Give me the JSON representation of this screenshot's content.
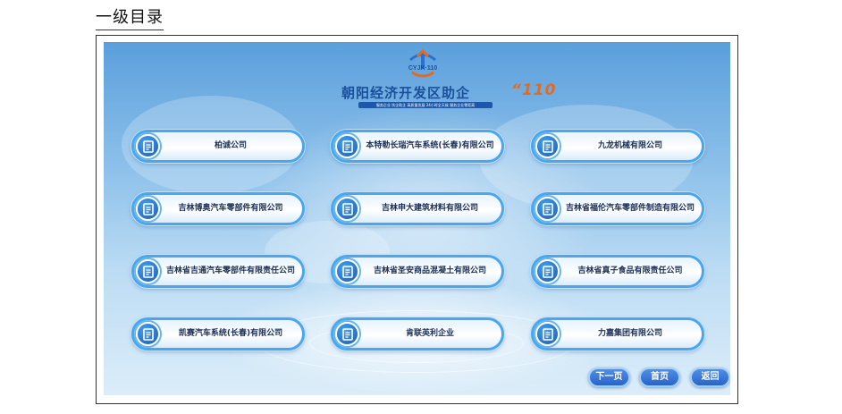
{
  "page_heading": "一级目录",
  "brand": {
    "logo_text": "CYJK·110",
    "title": "朝阳经济开发区助企",
    "title_number": "“110",
    "slogan": "服务企业 扶企助企 高质量发展 24小时全天候 服务企业零距离"
  },
  "companies": [
    {
      "label": "柏诚公司"
    },
    {
      "label": "本特勒长瑞汽车系统(长春)有限公司"
    },
    {
      "label": "九龙机械有限公司"
    },
    {
      "label": "吉林博奥汽车零部件有限公司"
    },
    {
      "label": "吉林申大建筑材料有限公司"
    },
    {
      "label": "吉林省福伦汽车零部件制造有限公司"
    },
    {
      "label": "吉林省吉通汽车零部件有限责任公司"
    },
    {
      "label": "吉林省圣安商品混凝土有限公司"
    },
    {
      "label": "吉林省真子食品有限责任公司"
    },
    {
      "label": "凯赛汽车系统(长春)有限公司"
    },
    {
      "label": "肯联英利企业"
    },
    {
      "label": "力嘉集团有限公司"
    }
  ],
  "nav": {
    "next_label": "下一页",
    "home_label": "首页",
    "back_label": "返回"
  },
  "icons": {
    "company_icon": "document-icon",
    "logo_icon": "cyjk-logo-icon"
  },
  "colors": {
    "accent": "#4ba6ec",
    "title_blue": "#1c4f9c",
    "title_orange": "#e56a1b",
    "nav_button": "#2a63c9"
  }
}
